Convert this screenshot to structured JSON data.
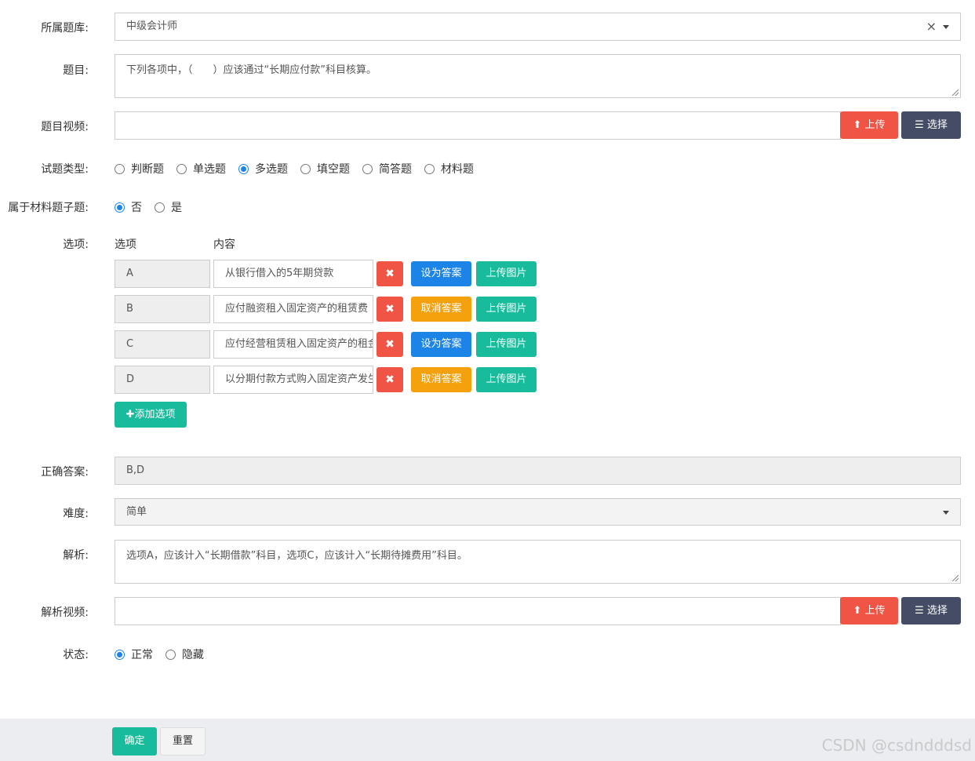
{
  "bank": {
    "label": "所属题库:",
    "value": "中级会计师",
    "clear_glyph": "×"
  },
  "question": {
    "label": "题目:",
    "value": "下列各项中，（　　）应该通过“长期应付款”科目核算。"
  },
  "question_video": {
    "label": "题目视频:",
    "value": "",
    "upload_label": "上传",
    "choose_label": "选择"
  },
  "question_type": {
    "label": "试题类型:",
    "options": [
      "判断题",
      "单选题",
      "多选题",
      "填空题",
      "简答题",
      "材料题"
    ],
    "selected": "多选题"
  },
  "is_sub_question": {
    "label": "属于材料题子题:",
    "options": [
      "否",
      "是"
    ],
    "selected": "否"
  },
  "choices": {
    "label": "选项:",
    "header_letter": "选项",
    "header_content": "内容",
    "delete_glyph": "✖",
    "upload_image_label": "上传图片",
    "add_label": "添加选项",
    "add_glyph": "✚",
    "rows": [
      {
        "letter": "A",
        "content": "从银行借入的5年期贷款",
        "answer_label": "设为答案",
        "is_answer": false
      },
      {
        "letter": "B",
        "content": "应付融资租入固定资产的租赁费",
        "answer_label": "取消答案",
        "is_answer": true
      },
      {
        "letter": "C",
        "content": "应付经营租赁租入固定资产的租金",
        "answer_label": "设为答案",
        "is_answer": false
      },
      {
        "letter": "D",
        "content": "以分期付款方式购入固定资产发生的应付款项",
        "answer_label": "取消答案",
        "is_answer": true
      }
    ]
  },
  "correct_answer": {
    "label": "正确答案:",
    "value": "B,D"
  },
  "difficulty": {
    "label": "难度:",
    "value": "简单"
  },
  "analysis": {
    "label": "解析:",
    "value": "选项A，应该计入“长期借款”科目，选项C，应该计入“长期待摊费用”科目。"
  },
  "analysis_video": {
    "label": "解析视频:",
    "value": "",
    "upload_label": "上传",
    "choose_label": "选择"
  },
  "status": {
    "label": "状态:",
    "options": [
      "正常",
      "隐藏"
    ],
    "selected": "正常"
  },
  "footer": {
    "confirm_label": "确定",
    "reset_label": "重置"
  },
  "watermark": "CSDN @csdndddsd",
  "colors": {
    "accent": "#18bc9c",
    "danger": "#f05445",
    "primary": "#1c84e6",
    "warning": "#f5a10e",
    "navy": "#444c66"
  }
}
